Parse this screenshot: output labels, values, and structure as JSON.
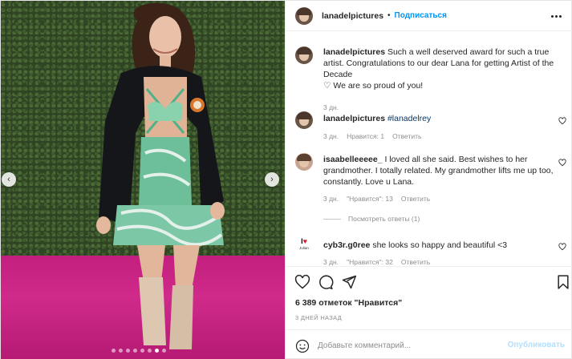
{
  "post": {
    "username": "lanadelpictures",
    "bullet": "•",
    "follow_label": "Подписаться",
    "more_icon": "more-horizontal-icon"
  },
  "media": {
    "carousel_dots": 8,
    "active_dot": 6,
    "prev_icon": "chevron-left-icon",
    "next_icon": "chevron-right-icon",
    "prev_glyph": "‹",
    "next_glyph": "›"
  },
  "caption": {
    "username": "lanadelpictures",
    "text": "Such a well deserved award for such a true artist. Congratulations to our dear Lana for getting Artist of the Decade",
    "heart": "♡",
    "text2": "We are so proud of you!",
    "time": "3 дн."
  },
  "comments": [
    {
      "username": "lanadelpictures",
      "text": "#lanadelrey",
      "time": "3 дн.",
      "likes": "Нравится: 1",
      "reply": "Ответить"
    },
    {
      "username": "isaabelleeeee_",
      "text": "I loved all she said. Best wishes to her grandmother. I totally related. My grandmother lifts me up too, constantly. Love u Lana.",
      "time": "3 дн.",
      "likes": "\"Нравится\": 13",
      "reply": "Ответить",
      "view_replies": "Посмотреть ответы (1)"
    },
    {
      "username": "cyb3r.g0ree",
      "text": "she looks so happy and beautiful <3",
      "time": "3 дн.",
      "likes": "\"Нравится\": 32",
      "reply": "Ответить",
      "avatar_logo_text": "I",
      "avatar_logo_heart": "♥",
      "avatar_logo_sub": "Julian"
    }
  ],
  "actions": {
    "like_icon": "heart-icon",
    "comment_icon": "comment-icon",
    "share_icon": "share-icon",
    "save_icon": "bookmark-icon"
  },
  "likes_text": "6 389 отметок \"Нравится\"",
  "posted_ago": "3 ДНЕЙ НАЗАД",
  "add_comment": {
    "placeholder": "Добавьте комментарий...",
    "publish_label": "Опубликовать",
    "emoji_icon": "emoji-icon"
  }
}
